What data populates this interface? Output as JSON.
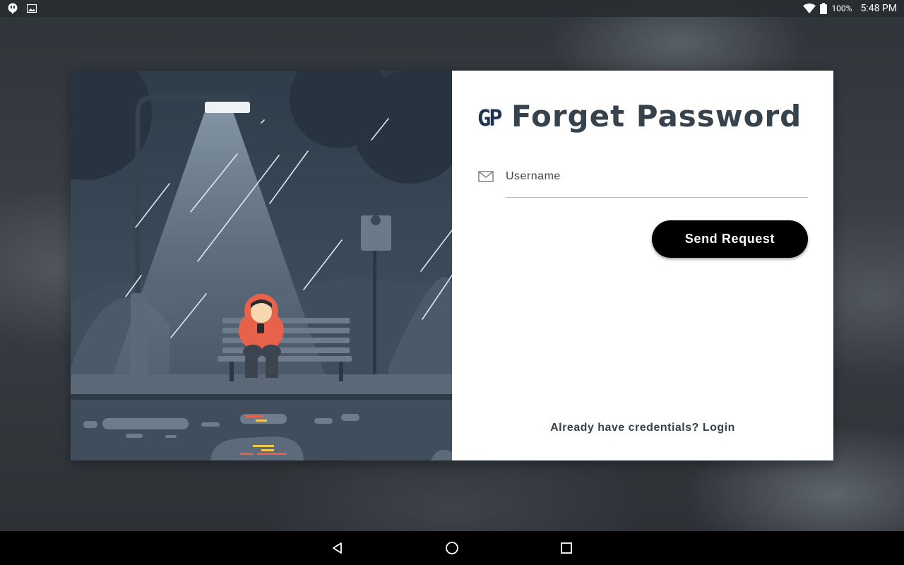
{
  "status_bar": {
    "battery": "100%",
    "time": "5:48 PM",
    "icons": [
      "notification-icon",
      "image-icon",
      "wifi-icon",
      "battery-icon"
    ]
  },
  "form": {
    "title": "Forget Password",
    "logo_text": "GP",
    "username_placeholder": "Username",
    "username_value": "",
    "send_button": "Send Request",
    "login_prompt": "Already have credentials?",
    "login_link": "Login"
  },
  "navigation": {
    "icons": [
      "back-icon",
      "home-icon",
      "recents-icon"
    ]
  },
  "colors": {
    "title": "#37434c",
    "button_bg": "#000000",
    "logo": "#1f3350"
  }
}
